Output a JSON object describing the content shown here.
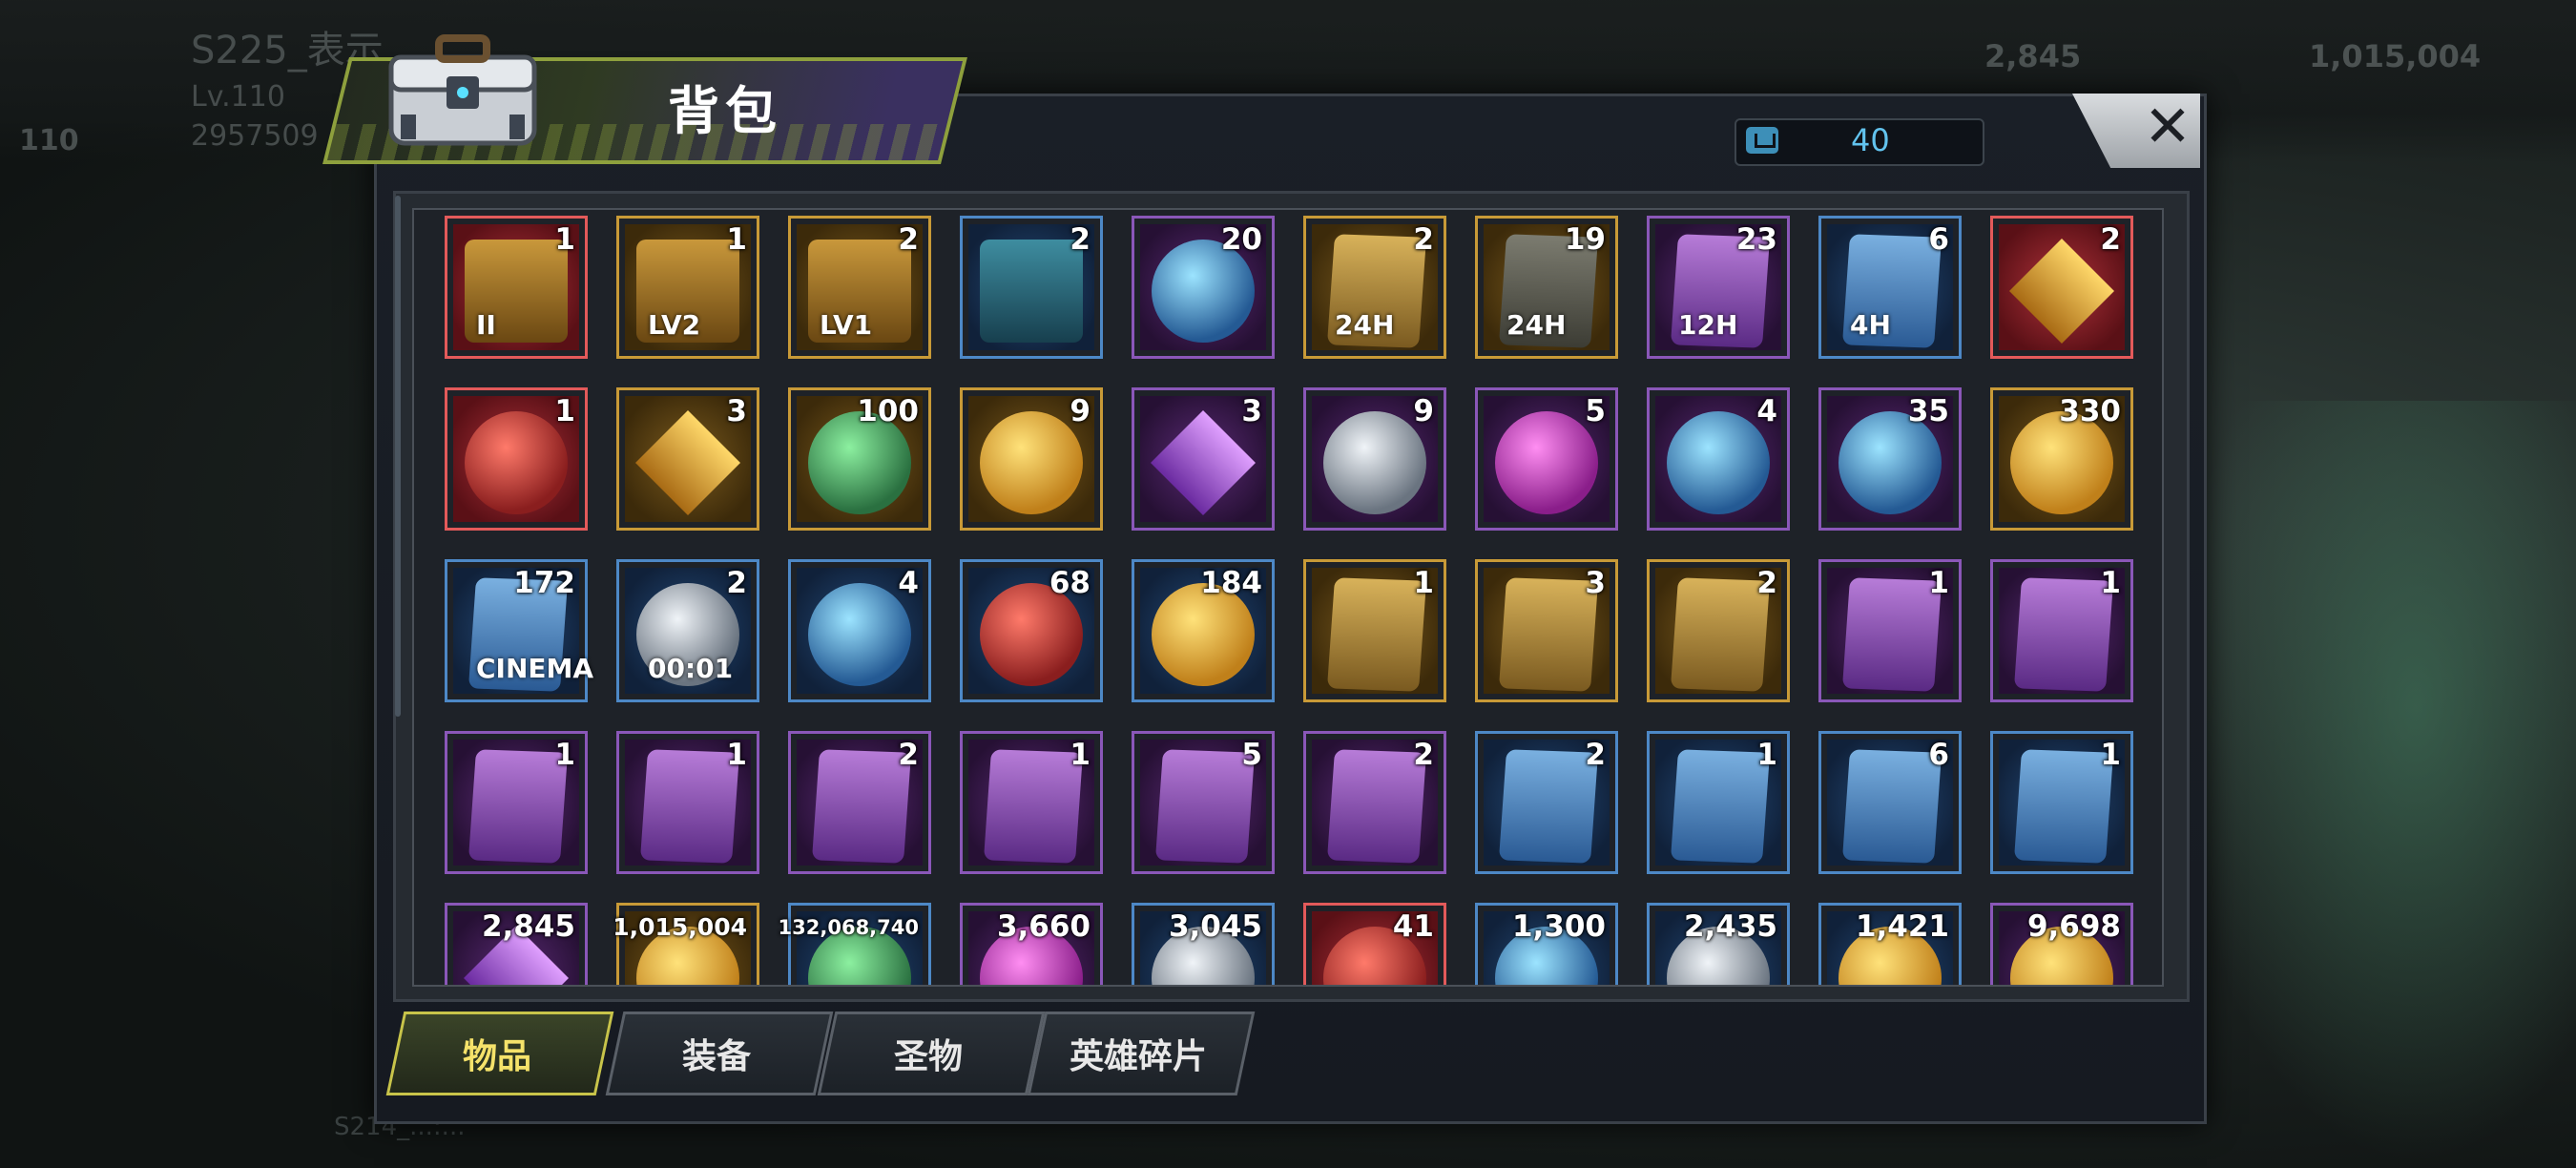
{
  "background": {
    "player_name": "S225_表示...",
    "player_level": "Lv.110",
    "player_power": "2957509",
    "side_level": "110",
    "resource_1": "2,845",
    "resource_2": "1,015,004",
    "chat_text": "S214_...:..."
  },
  "window": {
    "title": "背包",
    "capacity_value": "40",
    "close_label": "✕"
  },
  "tabs": [
    {
      "label": "物品",
      "active": true
    },
    {
      "label": "装备",
      "active": false
    },
    {
      "label": "圣物",
      "active": false
    },
    {
      "label": "英雄碎片",
      "active": false
    }
  ],
  "items": [
    {
      "name": "sss-chest-ii",
      "count": "1",
      "quality": "red",
      "art": "chest-art",
      "label": "II"
    },
    {
      "name": "purple-chest-lv2",
      "count": "1",
      "quality": "gold",
      "art": "chest-art",
      "label": "LV2"
    },
    {
      "name": "purple-chest-lv1",
      "count": "2",
      "quality": "gold",
      "art": "chest-art",
      "label": "LV1"
    },
    {
      "name": "s-chest",
      "count": "2",
      "quality": "blue",
      "art": "teal-chest",
      "label": ""
    },
    {
      "name": "swap-token",
      "count": "20",
      "quality": "purple",
      "art": "orb blue",
      "label": ""
    },
    {
      "name": "speedup-24h-gold",
      "count": "2",
      "quality": "gold",
      "art": "card",
      "label": "24H"
    },
    {
      "name": "speedup-24h-grey",
      "count": "19",
      "quality": "gold",
      "art": "card g",
      "label": "24H"
    },
    {
      "name": "speedup-12h",
      "count": "23",
      "quality": "purple",
      "art": "card p",
      "label": "12H"
    },
    {
      "name": "speedup-4h",
      "count": "6",
      "quality": "blue",
      "art": "card b",
      "label": "4H"
    },
    {
      "name": "red-cube",
      "count": "2",
      "quality": "red",
      "art": "diamond",
      "label": ""
    },
    {
      "name": "hammer",
      "count": "1",
      "quality": "red",
      "art": "orb red",
      "label": ""
    },
    {
      "name": "gold-shard",
      "count": "3",
      "quality": "gold",
      "art": "diamond",
      "label": ""
    },
    {
      "name": "chip-stack",
      "count": "100",
      "quality": "gold",
      "art": "orb green",
      "label": ""
    },
    {
      "name": "golden-egg",
      "count": "9",
      "quality": "gold",
      "art": "orb",
      "label": ""
    },
    {
      "name": "mystery-box",
      "count": "3",
      "quality": "purple",
      "art": "diamond p",
      "label": ""
    },
    {
      "name": "film-reel",
      "count": "9",
      "quality": "purple",
      "art": "orb silver",
      "label": ""
    },
    {
      "name": "pink-cap",
      "count": "5",
      "quality": "purple",
      "art": "orb pink",
      "label": ""
    },
    {
      "name": "spade-chip",
      "count": "4",
      "quality": "purple",
      "art": "orb blue",
      "label": ""
    },
    {
      "name": "police-badge",
      "count": "35",
      "quality": "purple",
      "art": "orb blue",
      "label": ""
    },
    {
      "name": "gold-orbs",
      "count": "330",
      "quality": "gold",
      "art": "orb",
      "label": ""
    },
    {
      "name": "cinema-ticket",
      "count": "172",
      "quality": "blue",
      "art": "card b",
      "label": "CINEMA"
    },
    {
      "name": "timer-coin",
      "count": "2",
      "quality": "blue",
      "art": "orb silver",
      "label": "00:01"
    },
    {
      "name": "b-cap",
      "count": "4",
      "quality": "blue",
      "art": "orb blue",
      "label": ""
    },
    {
      "name": "poker-chip",
      "count": "68",
      "quality": "blue",
      "art": "orb red",
      "label": ""
    },
    {
      "name": "bullet",
      "count": "184",
      "quality": "blue",
      "art": "orb",
      "label": ""
    },
    {
      "name": "blueprint-hat-gold",
      "count": "1",
      "quality": "gold",
      "art": "card",
      "label": ""
    },
    {
      "name": "blueprint-shirt-gold",
      "count": "3",
      "quality": "gold",
      "art": "card",
      "label": ""
    },
    {
      "name": "blueprint-glasses-gold",
      "count": "2",
      "quality": "gold",
      "art": "card",
      "label": ""
    },
    {
      "name": "blueprint-glasses-purple",
      "count": "1",
      "quality": "purple",
      "art": "card p",
      "label": ""
    },
    {
      "name": "blueprint-boots-purple",
      "count": "1",
      "quality": "purple",
      "art": "card p",
      "label": ""
    },
    {
      "name": "blueprint-hat-purple",
      "count": "1",
      "quality": "purple",
      "art": "card p",
      "label": ""
    },
    {
      "name": "blueprint-shirt-purple",
      "count": "1",
      "quality": "purple",
      "art": "card p",
      "label": ""
    },
    {
      "name": "blueprint-hat-purple-2",
      "count": "2",
      "quality": "purple",
      "art": "card p",
      "label": ""
    },
    {
      "name": "blueprint-glasses-purple-2",
      "count": "1",
      "quality": "purple",
      "art": "card p",
      "label": ""
    },
    {
      "name": "blueprint-shirt-purple-2",
      "count": "5",
      "quality": "purple",
      "art": "card p",
      "label": ""
    },
    {
      "name": "blueprint-sword-purple",
      "count": "2",
      "quality": "purple",
      "art": "card p",
      "label": ""
    },
    {
      "name": "blueprint-boots-blue",
      "count": "2",
      "quality": "blue",
      "art": "card b",
      "label": ""
    },
    {
      "name": "blueprint-shirt-blue",
      "count": "1",
      "quality": "blue",
      "art": "card b",
      "label": ""
    },
    {
      "name": "blueprint-gun-blue",
      "count": "6",
      "quality": "blue",
      "art": "card b",
      "label": ""
    },
    {
      "name": "blueprint-hat-blue",
      "count": "1",
      "quality": "blue",
      "art": "card b",
      "label": ""
    },
    {
      "name": "purple-gems",
      "count": "2,845",
      "quality": "purple",
      "art": "diamond p",
      "label": ""
    },
    {
      "name": "gold-coins",
      "count": "1,015,004",
      "quality": "gold",
      "art": "orb",
      "label": ""
    },
    {
      "name": "green-cash",
      "count": "132,068,740",
      "quality": "blue",
      "art": "orb green",
      "label": ""
    },
    {
      "name": "purple-alarm",
      "count": "3,660",
      "quality": "purple",
      "art": "orb pink",
      "label": ""
    },
    {
      "name": "gear-parts",
      "count": "3,045",
      "quality": "blue",
      "art": "orb silver",
      "label": ""
    },
    {
      "name": "red-molecule",
      "count": "41",
      "quality": "red",
      "art": "orb red",
      "label": ""
    },
    {
      "name": "armor-piece",
      "count": "1,300",
      "quality": "blue",
      "art": "orb blue",
      "label": ""
    },
    {
      "name": "triangle-core",
      "count": "2,435",
      "quality": "blue",
      "art": "orb silver",
      "label": ""
    },
    {
      "name": "gold-fist",
      "count": "1,421",
      "quality": "blue",
      "art": "orb",
      "label": ""
    },
    {
      "name": "gold-pile",
      "count": "9,698",
      "quality": "purple",
      "art": "orb",
      "label": ""
    }
  ],
  "colors": {
    "accent": "#c8c44a",
    "count_text": "#ffffff",
    "capacity_text": "#62c3ee"
  }
}
